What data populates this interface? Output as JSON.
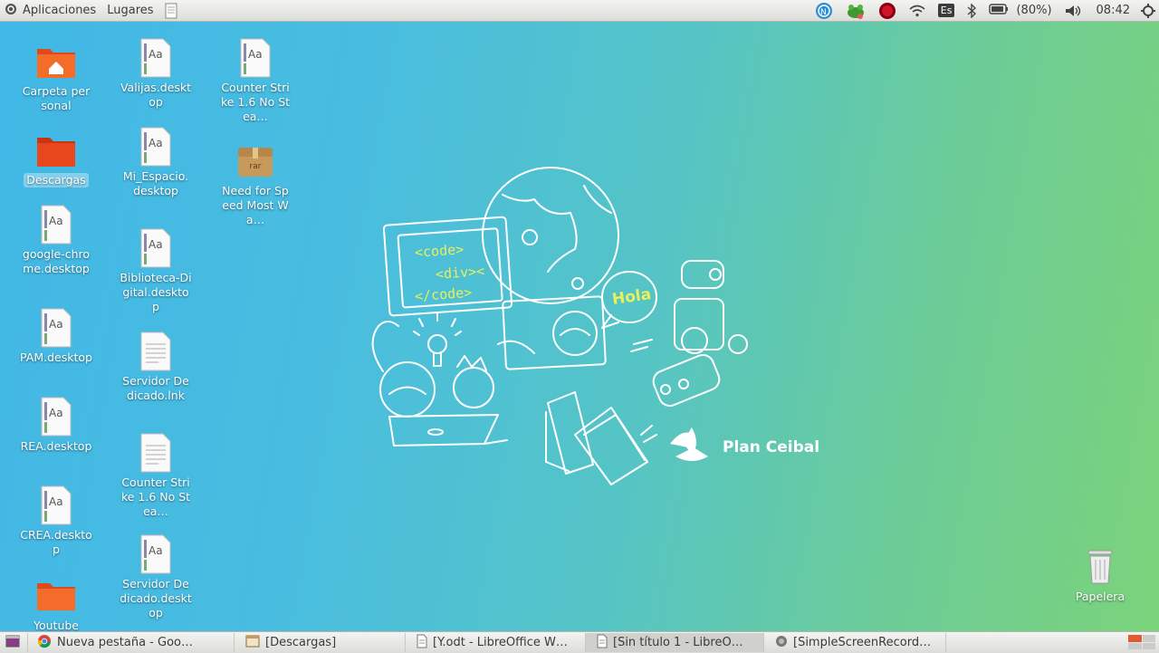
{
  "top_panel": {
    "menu_applications": "Aplicaciones",
    "menu_places": "Lugares",
    "keyboard_layout": "Es",
    "battery": "(80%)",
    "clock": "08:42"
  },
  "desktop_icons": {
    "carpeta_personal": "Carpeta personal",
    "descargas": "Descargas",
    "google_chrome": "google-chrome.desktop",
    "pam": "PAM.desktop",
    "rea": "REA.desktop",
    "crea": "CREA.desktop",
    "youtube": "Youtube",
    "valijas": "Valijas.desktop",
    "mi_espacio": "Mi_Espacio.desktop",
    "biblioteca": "Biblioteca-Digital.desktop",
    "servidor_lnk": "Servidor Dedicado.lnk",
    "counter_strike_2": "Counter Strike 1.6 No Stea…",
    "servidor_desktop": "Servidor Dedicado.desktop",
    "counter_strike_1": "Counter Strike 1.6 No Stea…",
    "need_for_speed": "Need for Speed Most Wa…",
    "papelera": "Papelera",
    "archive_badge": "rar"
  },
  "wallpaper": {
    "brand": "Plan Ceibal",
    "code_open": "<code>",
    "code_div": "<div><",
    "code_close": "</code>",
    "speech": "Hola"
  },
  "taskbar": {
    "tasks": [
      {
        "label": "Nueva pestaña - Goo…"
      },
      {
        "label": "[Descargas]"
      },
      {
        "label": "[Y.odt - LibreOffice W…"
      },
      {
        "label": "[Sin título 1 - LibreO…"
      },
      {
        "label": "[SimpleScreenRecord…"
      }
    ]
  },
  "colors": {
    "panel": "#e8e8e4",
    "folder_orange": "#f05a28",
    "wallpaper_left": "#41b7e6",
    "wallpaper_right": "#7bd37a"
  },
  "icons": [
    "ubuntu-logo-icon",
    "notes-icon",
    "network-indicator-icon",
    "frog-icon",
    "record-icon",
    "wifi-icon",
    "bluetooth-icon",
    "battery-icon",
    "volume-icon",
    "power-icon",
    "show-desktop-icon",
    "chrome-icon",
    "folder-icon",
    "document-icon",
    "web-icon",
    "trash-icon",
    "workspace-switcher-icon"
  ]
}
